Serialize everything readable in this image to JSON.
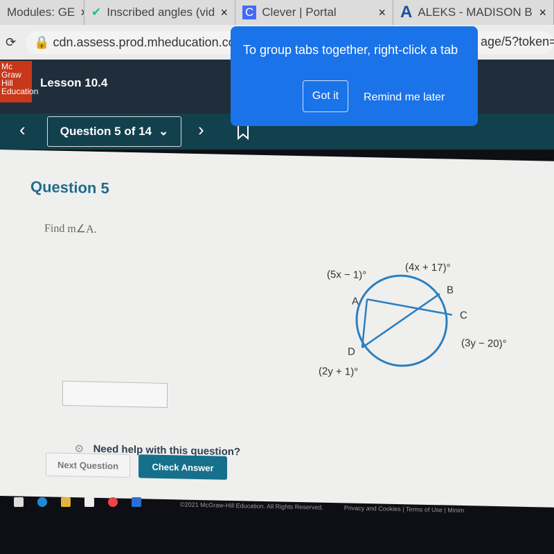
{
  "browser": {
    "tabs": [
      {
        "title": "Modules: GE"
      },
      {
        "title": "Inscribed angles (vid"
      },
      {
        "title": "Clever | Portal"
      },
      {
        "title": "ALEKS - MADISON B"
      }
    ],
    "close": "×",
    "url": "cdn.assess.prod.mheducation.com",
    "url_tail": "age/5?token="
  },
  "popup": {
    "message": "To group tabs together, right-click a tab",
    "got_it": "Got it",
    "remind": "Remind me later"
  },
  "header": {
    "logo": "Mc Graw Hill Education",
    "lesson": "Lesson 10.4"
  },
  "nav": {
    "question_selector": "Question 5 of 14",
    "prev": "‹",
    "next": "›"
  },
  "question": {
    "title": "Question 5",
    "prompt": "Find m∠A.",
    "diagram": {
      "labels": {
        "A": "A",
        "B": "B",
        "C": "C",
        "D": "D",
        "arc_ab": "(5x − 1)°",
        "arc_bc": "(4x + 17)°",
        "arc_cd": "(3y − 20)°",
        "arc_da": "(2y + 1)°"
      }
    },
    "answer_value": ""
  },
  "help": "Need help with this question?",
  "buttons": {
    "next": "Next Question",
    "check": "Check Answer"
  },
  "footer": {
    "copyright": "©2021 McGraw-Hill Education. All Rights Reserved.",
    "links": "Privacy and Cookies | Terms of Use | Minim"
  },
  "colors": {
    "accent": "#1e6c8c",
    "popup": "#1a73e8",
    "header": "#1f2e3a"
  }
}
